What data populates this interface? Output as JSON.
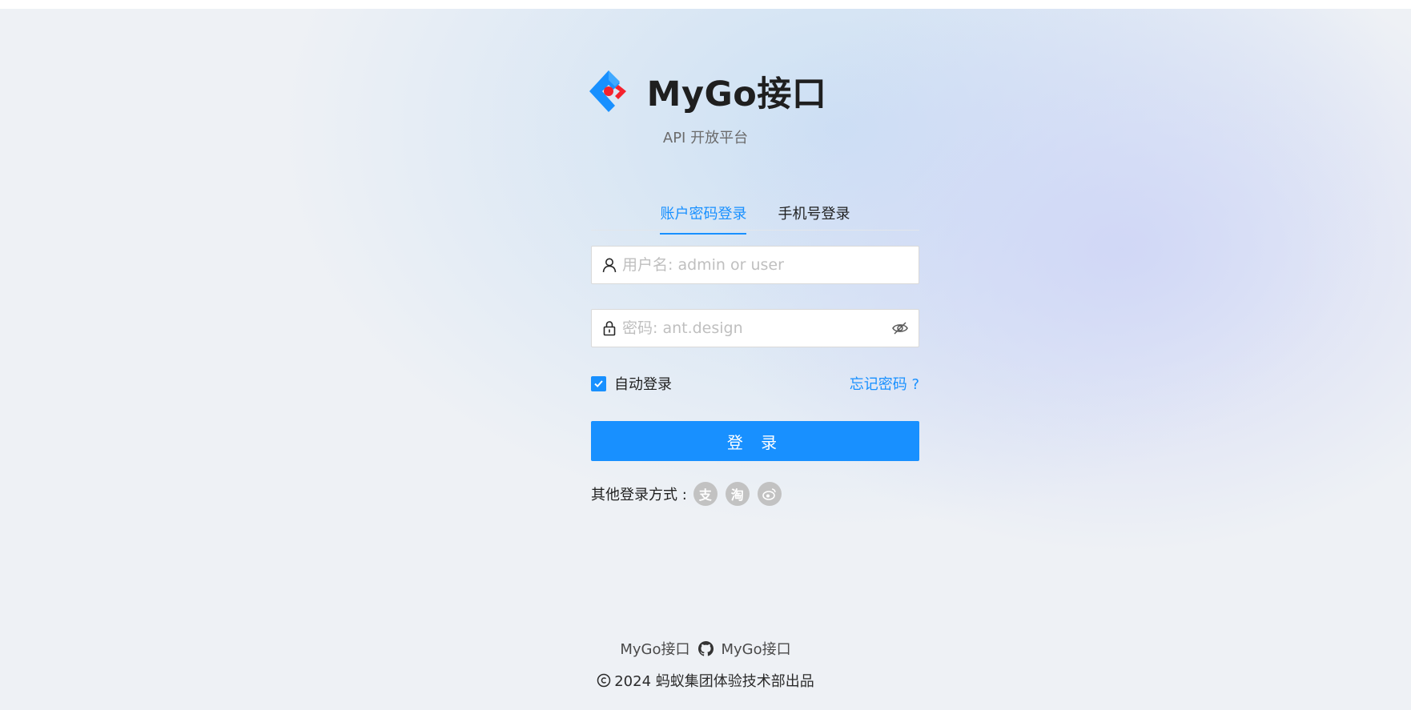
{
  "app": {
    "title": "MyGo接口",
    "subtitle": "API 开放平台",
    "logo_icon": "ant-design-logo-icon"
  },
  "tabs": [
    {
      "label": "账户密码登录",
      "active": true
    },
    {
      "label": "手机号登录",
      "active": false
    }
  ],
  "form": {
    "username": {
      "placeholder": "用户名: admin or user",
      "value": "",
      "icon": "user-icon"
    },
    "password": {
      "placeholder": "密码: ant.design",
      "value": "",
      "icon": "lock-icon",
      "suffix_icon": "eye-invisible-icon"
    },
    "remember": {
      "label": "自动登录",
      "checked": true
    },
    "forgot_label": "忘记密码 ?",
    "submit_label": "登 录"
  },
  "other_login": {
    "label": "其他登录方式 :",
    "providers": [
      {
        "glyph": "支",
        "icon": "alipay-icon"
      },
      {
        "glyph": "淘",
        "icon": "taobao-icon"
      },
      {
        "glyph": "",
        "icon": "weibo-icon"
      }
    ]
  },
  "footer": {
    "links": [
      "MyGo接口",
      "MyGo接口"
    ],
    "github_icon": "github-icon",
    "copyright": "2024 蚂蚁集团体验技术部出品"
  },
  "colors": {
    "primary": "#1890ff",
    "logo_red": "#f5222d",
    "text": "#1f1f1f",
    "social_bg": "#c2c2c2"
  }
}
